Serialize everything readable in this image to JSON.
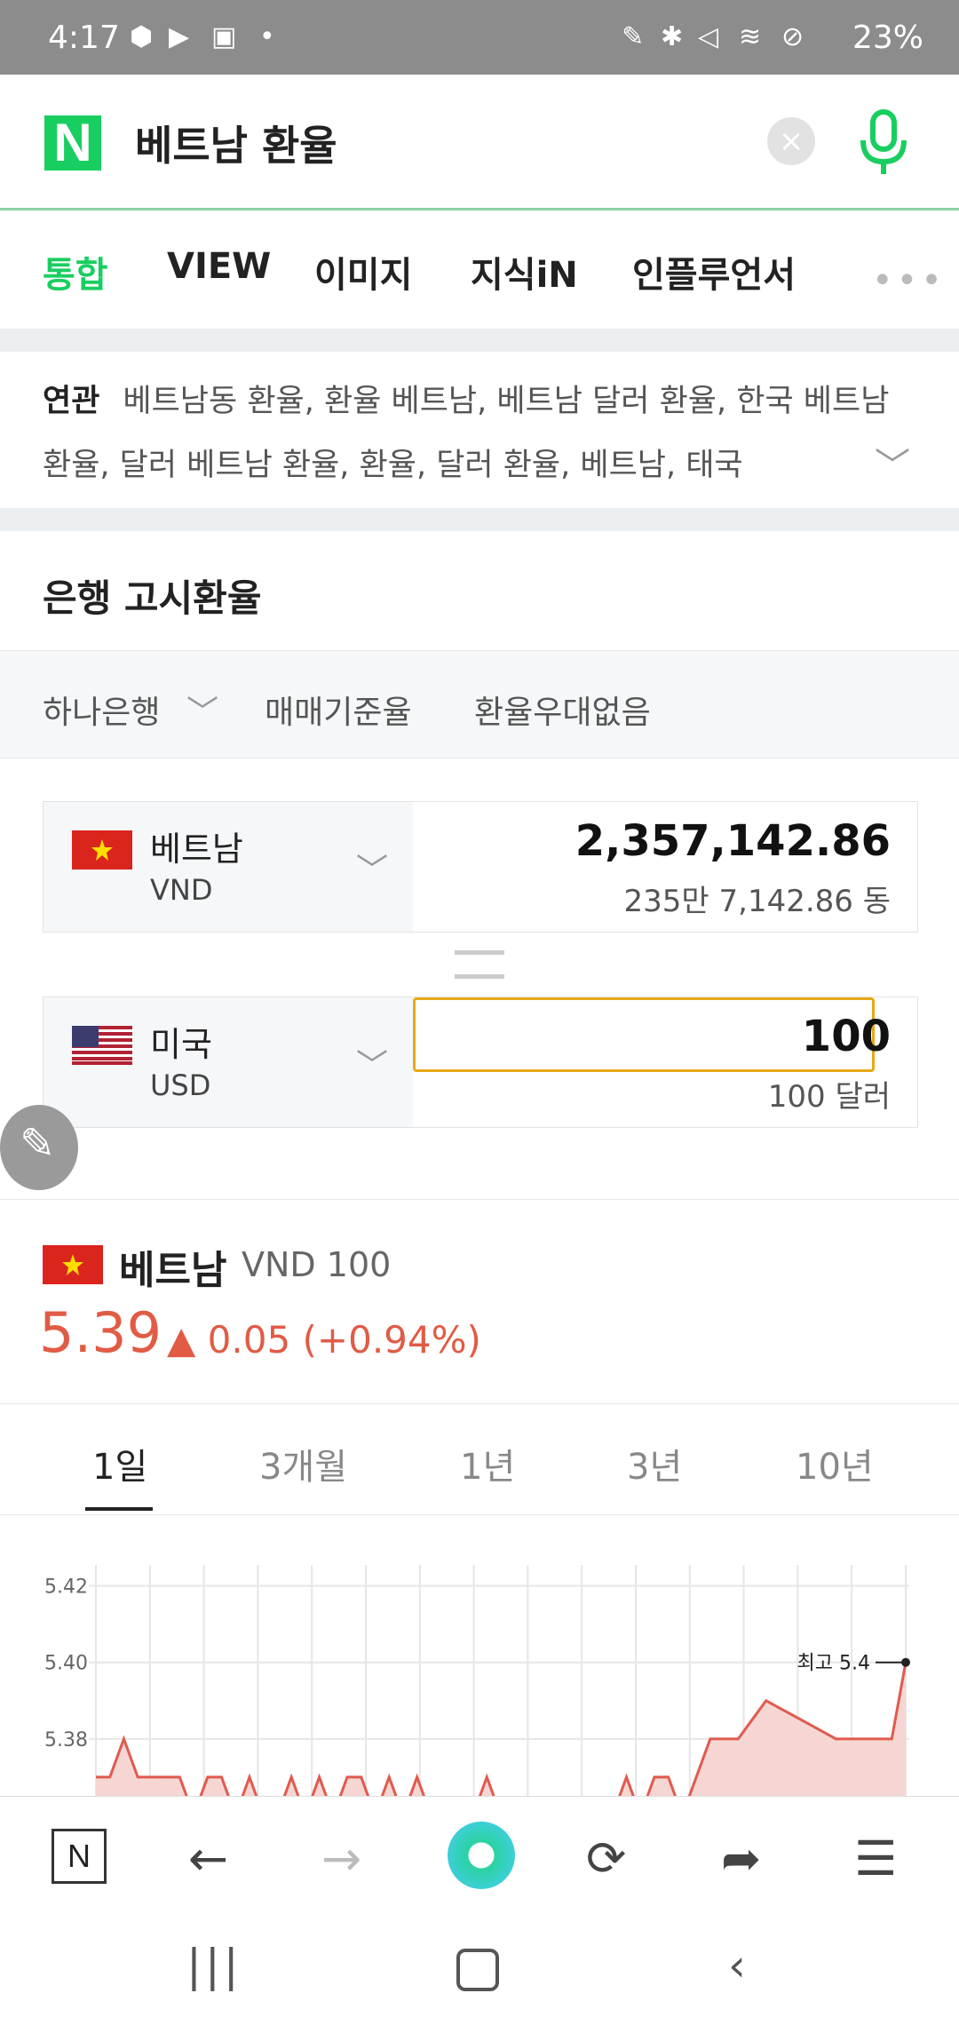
{
  "status_bar": {
    "time": "4:17",
    "battery": "23%"
  },
  "search": {
    "logo": "N",
    "query": "베트남 환율"
  },
  "tabs": [
    {
      "label": "통합",
      "active": true
    },
    {
      "label": "VIEW"
    },
    {
      "label": "이미지"
    },
    {
      "label": "지식iN"
    },
    {
      "label": "인플루언서"
    }
  ],
  "related": {
    "label": "연관",
    "text": "베트남동 환율, 환율 베트남, 베트남 달러 환율, 한국 베트남 환율, 달러 베트남 환율, 환율, 달러 환율, 베트남, 태국"
  },
  "bank_section": {
    "title": "은행 고시환율",
    "bank": "하나은행",
    "rate_type": "매매기준율",
    "discount": "환율우대없음"
  },
  "converter": {
    "from": {
      "country": "베트남",
      "code": "VND",
      "amount": "2,357,142.86",
      "amount_text": "235만 7,142.86 동"
    },
    "to": {
      "country": "미국",
      "code": "USD",
      "amount": "100",
      "amount_text": "100 달러"
    }
  },
  "rate": {
    "country": "베트남",
    "code": "VND 100",
    "value": "5.39",
    "change": "▲ 0.05 (+0.94%)"
  },
  "periods": [
    {
      "label": "1일",
      "active": true
    },
    {
      "label": "3개월"
    },
    {
      "label": "1년"
    },
    {
      "label": "3년"
    },
    {
      "label": "10년"
    }
  ],
  "chart_data": {
    "type": "area",
    "y_ticks": [
      "5.42",
      "5.40",
      "5.38"
    ],
    "ylim": [
      5.36,
      5.425
    ],
    "annotation": "최고 5.4",
    "series": [
      {
        "color": "#e05a4e",
        "values": [
          5.37,
          5.37,
          5.38,
          5.37,
          5.37,
          5.37,
          5.37,
          5.36,
          5.37,
          5.37,
          5.36,
          5.37,
          5.36,
          5.36,
          5.37,
          5.36,
          5.37,
          5.36,
          5.37,
          5.37,
          5.36,
          5.37,
          5.36,
          5.37,
          5.36,
          5.36,
          5.36,
          5.36,
          5.37,
          5.36,
          5.36,
          5.36,
          5.36,
          5.36,
          5.36,
          5.36,
          5.36,
          5.36,
          5.37,
          5.36,
          5.37,
          5.37,
          5.36,
          5.37,
          5.38,
          5.38,
          5.38,
          5.385,
          5.39,
          5.388,
          5.386,
          5.384,
          5.382,
          5.38,
          5.38,
          5.38,
          5.38,
          5.38,
          5.4
        ]
      }
    ]
  },
  "bottom_nav": [
    "N",
    "←",
    "→",
    "●",
    "⟳",
    "➦",
    "☰"
  ],
  "colors": {
    "naver_green": "#19ce60",
    "rate_red": "#e15b45",
    "input_border": "#e8a817"
  }
}
